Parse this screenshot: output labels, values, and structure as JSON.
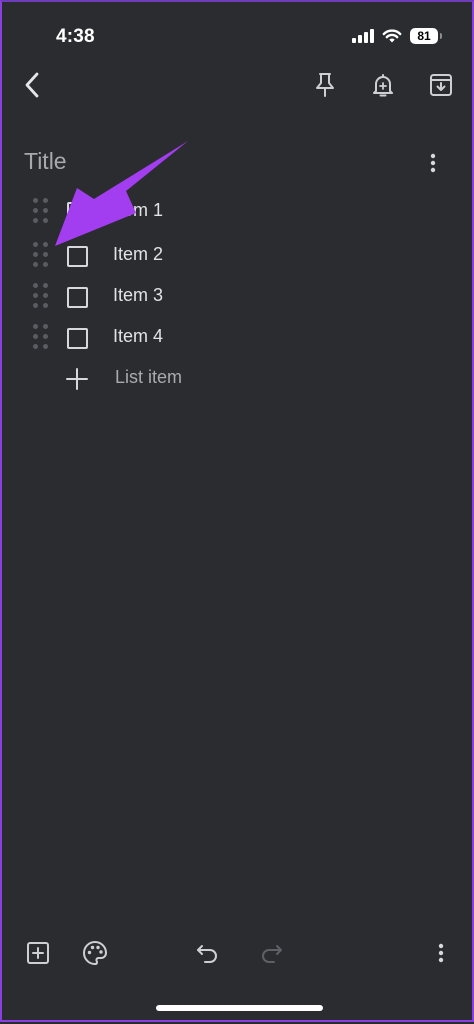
{
  "status_bar": {
    "time": "4:38",
    "battery": "81"
  },
  "toolbar": {
    "back_icon": "chevron-left-icon",
    "pin_icon": "pin-icon",
    "reminder_icon": "bell-plus-icon",
    "archive_icon": "archive-icon"
  },
  "note": {
    "title_placeholder": "Title",
    "items": [
      {
        "label": "Item 1",
        "checked": false
      },
      {
        "label": "Item 2",
        "checked": false
      },
      {
        "label": "Item 3",
        "checked": false
      },
      {
        "label": "Item 4",
        "checked": false
      }
    ],
    "add_item_label": "List item"
  },
  "bottom_bar": {
    "add_icon": "add-box-icon",
    "palette_icon": "palette-icon",
    "undo_icon": "undo-icon",
    "redo_icon": "redo-icon",
    "more_icon": "more-vertical-icon"
  },
  "colors": {
    "background": "#2b2c30",
    "annotation": "#a23ef0",
    "frame_border": "#8a40e0"
  }
}
